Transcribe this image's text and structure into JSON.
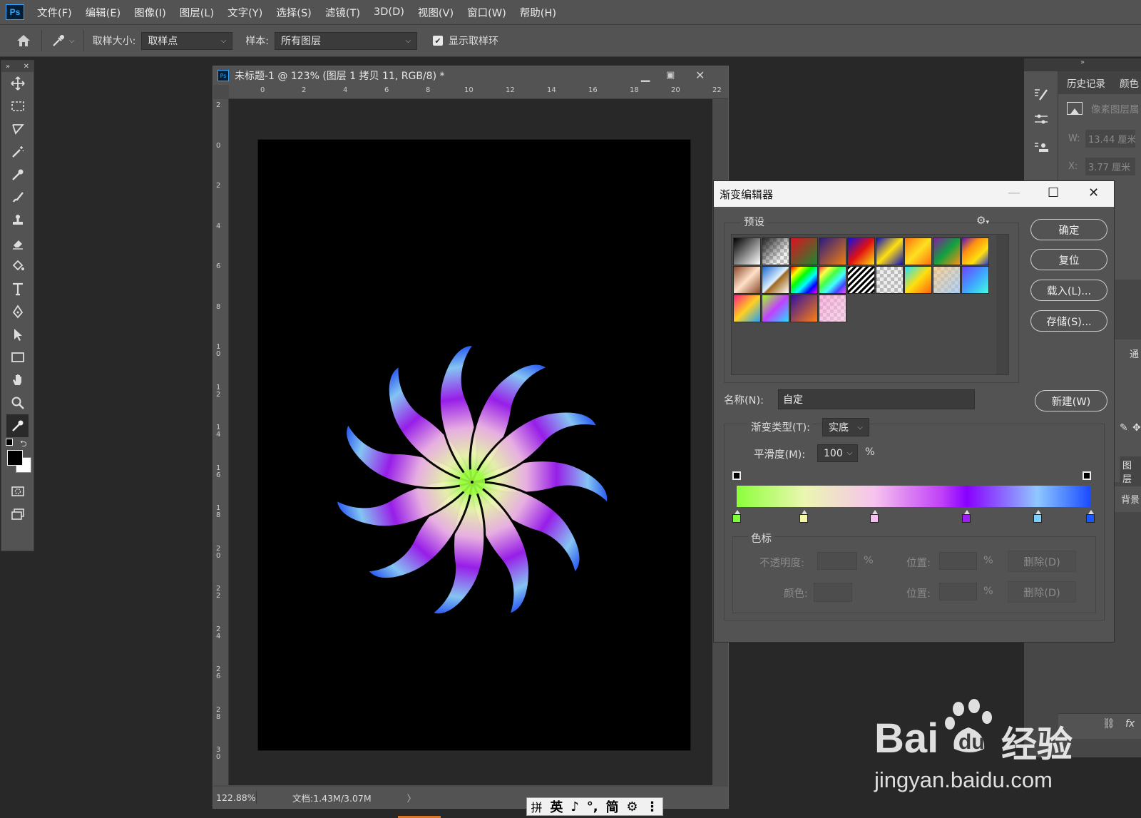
{
  "menubar": {
    "logo": "Ps",
    "items": [
      "文件(F)",
      "编辑(E)",
      "图像(I)",
      "图层(L)",
      "文字(Y)",
      "选择(S)",
      "滤镜(T)",
      "3D(D)",
      "视图(V)",
      "窗口(W)",
      "帮助(H)"
    ]
  },
  "options": {
    "sample_size_label": "取样大小:",
    "sample_size_value": "取样点",
    "sample_label": "样本:",
    "sample_value": "所有图层",
    "show_ring_label": "显示取样环",
    "show_ring_checked": true
  },
  "document": {
    "title": "未标题-1 @ 123% (图层 1 拷贝 11, RGB/8) *",
    "ruler_h": [
      "0",
      "2",
      "4",
      "6",
      "8",
      "10",
      "12",
      "14",
      "16",
      "18",
      "20",
      "22"
    ],
    "ruler_v": [
      "2",
      "0",
      "2",
      "4",
      "6",
      "8",
      "1\n0",
      "1\n2",
      "1\n4",
      "1\n6",
      "1\n8",
      "2\n0",
      "2\n2",
      "2\n4",
      "2\n6",
      "2\n8",
      "3\n0"
    ],
    "zoom": "122.88%",
    "doc_info": "文档:1.43M/3.07M",
    "status_arrow": "〉"
  },
  "right_panel": {
    "tab_history": "历史记录",
    "tab_color": "颜色",
    "prop_title": "像素图层属",
    "w_label": "W:",
    "w_value": "13.44 厘米",
    "x_label": "X:",
    "x_value": "3.77 厘米",
    "tab_channels": "通",
    "layers_tab": "图层",
    "layer_bg": "背景",
    "fx": "fx"
  },
  "gradient_editor": {
    "title": "渐变编辑器",
    "presets_label": "预设",
    "ok": "确定",
    "reset": "复位",
    "load": "载入(L)...",
    "save": "存储(S)...",
    "name_label": "名称(N):",
    "name_value": "自定",
    "new_button": "新建(W)",
    "type_label": "渐变类型(T):",
    "type_value": "实底",
    "smooth_label": "平滑度(M):",
    "smooth_value": "100",
    "percent": "%",
    "stops_label": "色标",
    "opacity_label": "不透明度:",
    "position_label": "位置:",
    "delete_label": "删除(D)",
    "color_label": "颜色:",
    "color_stops": [
      {
        "pos": 0,
        "color": "#7dff3a"
      },
      {
        "pos": 19,
        "color": "#f2f7a6"
      },
      {
        "pos": 39,
        "color": "#f7bff0"
      },
      {
        "pos": 65,
        "color": "#9a1ef5"
      },
      {
        "pos": 85,
        "color": "#7ed0ff"
      },
      {
        "pos": 100,
        "color": "#1a55ff"
      }
    ]
  },
  "ime": {
    "items": [
      "拼",
      "英",
      "♪",
      "°,",
      "简",
      "⚙",
      "⋮"
    ]
  },
  "watermark": {
    "brand": "Bai",
    "paw": "du",
    "cn": "经验",
    "url": "jingyan.baidu.com"
  }
}
